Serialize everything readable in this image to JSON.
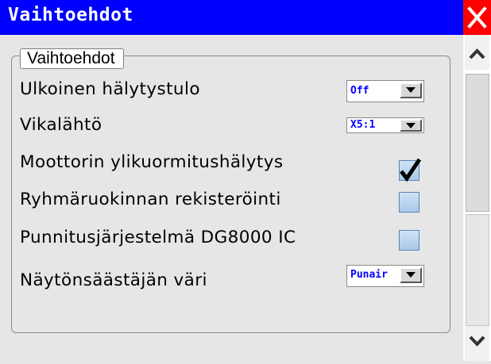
{
  "window": {
    "title": "Vaihtoehdot"
  },
  "group": {
    "label": "Vaihtoehdot"
  },
  "rows": {
    "external_alarm": {
      "label": "Ulkoinen hälytystulo",
      "value": "Off"
    },
    "fault_output": {
      "label": "Vikalähtö",
      "value": "X5:1"
    },
    "motor_overload": {
      "label": "Moottorin ylikuormitushälytys",
      "checked": true
    },
    "group_feeding": {
      "label": "Ryhmäruokinnan rekisteröinti",
      "checked": false
    },
    "weighing_system": {
      "label": "Punnitusjärjestelmä DG8000 IC",
      "checked": false
    },
    "screensaver_color": {
      "label": "Näytönsäästäjän väri",
      "value": "Punair"
    }
  },
  "icons": {
    "close": "close-icon",
    "dropdown": "triangle-down-icon",
    "scroll_up": "chevron-up-icon",
    "scroll_down": "chevron-down-icon",
    "check": "checkmark-icon"
  },
  "colors": {
    "title_bar": "#0000ff",
    "close_button": "#ff0000",
    "dropdown_text": "#0000ff",
    "checkbox_fill": "#a9c8e8"
  }
}
